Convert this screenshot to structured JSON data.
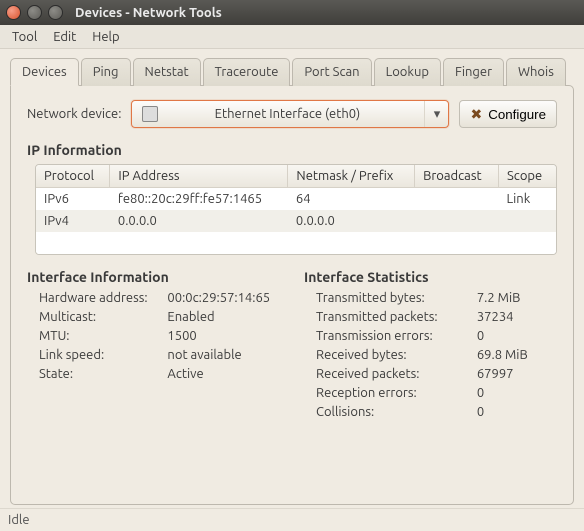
{
  "window": {
    "title": "Devices - Network Tools"
  },
  "menubar": {
    "tool": "Tool",
    "edit": "Edit",
    "help": "Help"
  },
  "tabs": {
    "devices": "Devices",
    "ping": "Ping",
    "netstat": "Netstat",
    "traceroute": "Traceroute",
    "portscan": "Port Scan",
    "lookup": "Lookup",
    "finger": "Finger",
    "whois": "Whois"
  },
  "device_row": {
    "label": "Network device:",
    "selected": "Ethernet Interface (eth0)",
    "configure": "Configure"
  },
  "ip_section": {
    "heading": "IP Information",
    "headers": {
      "protocol": "Protocol",
      "ip": "IP Address",
      "netmask": "Netmask / Prefix",
      "broadcast": "Broadcast",
      "scope": "Scope"
    },
    "rows": [
      {
        "protocol": "IPv6",
        "ip": "fe80::20c:29ff:fe57:1465",
        "netmask": "64",
        "broadcast": "",
        "scope": "Link"
      },
      {
        "protocol": "IPv4",
        "ip": "0.0.0.0",
        "netmask": "0.0.0.0",
        "broadcast": "",
        "scope": ""
      }
    ]
  },
  "iface_info": {
    "heading": "Interface Information",
    "rows": {
      "hwaddr_k": "Hardware address:",
      "hwaddr_v": "00:0c:29:57:14:65",
      "multicast_k": "Multicast:",
      "multicast_v": "Enabled",
      "mtu_k": "MTU:",
      "mtu_v": "1500",
      "speed_k": "Link speed:",
      "speed_v": "not available",
      "state_k": "State:",
      "state_v": "Active"
    }
  },
  "iface_stats": {
    "heading": "Interface Statistics",
    "rows": {
      "txb_k": "Transmitted bytes:",
      "txb_v": "7.2 MiB",
      "txp_k": "Transmitted packets:",
      "txp_v": "37234",
      "txe_k": "Transmission errors:",
      "txe_v": "0",
      "rxb_k": "Received bytes:",
      "rxb_v": "69.8 MiB",
      "rxp_k": "Received packets:",
      "rxp_v": "67997",
      "rxe_k": "Reception errors:",
      "rxe_v": "0",
      "col_k": "Collisions:",
      "col_v": "0"
    }
  },
  "status": "Idle"
}
